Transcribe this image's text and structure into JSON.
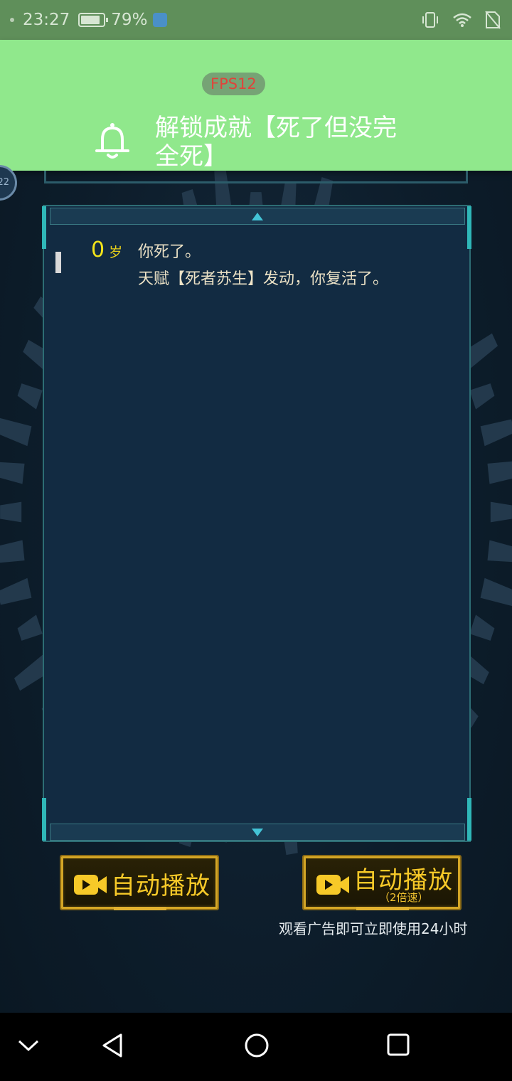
{
  "status_bar": {
    "time": "23:27",
    "battery": "79%"
  },
  "notification": {
    "text": "解锁成就【死了但没完全死】",
    "fps_label": "FPS12"
  },
  "side_badge": "22",
  "log": {
    "entries": [
      {
        "age": "0",
        "age_unit": "岁",
        "line1": "你死了。",
        "line2": "天赋【死者苏生】发动，你复活了。"
      }
    ]
  },
  "buttons": {
    "auto_play": "自动播放",
    "auto_play_2x": "自动播放",
    "auto_play_2x_sub": "（2倍速）",
    "ad_hint": "观看广告即可立即使用24小时"
  },
  "colors": {
    "accent_gold": "#f7c928",
    "age_yellow": "#f3e41a",
    "notification_green": "#90e88c",
    "panel_bg": "#122b42"
  },
  "icons": [
    "bell-icon",
    "camera-icon",
    "back-icon",
    "home-icon",
    "recents-icon",
    "collapse-icon"
  ]
}
